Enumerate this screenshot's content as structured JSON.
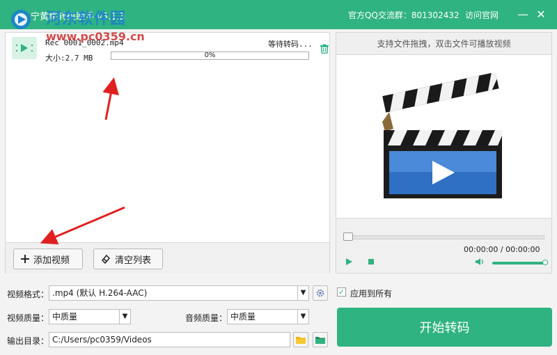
{
  "titlebar": {
    "app_title": "宁黄格转码助手 v3.1.3",
    "watermark_text": "河东软件园",
    "watermark_url": "www.pc0359.cn",
    "qq_group": "官方QQ交流群：801302432",
    "visit_site": "访问官网",
    "minimize_icon": "minimize-icon",
    "close_icon": "close-icon"
  },
  "file_list": {
    "items": [
      {
        "name": "Rec 0001_0002.mp4",
        "size": "大小:2.7 MB",
        "status": "等待转码...",
        "progress_text": "0%",
        "progress": 0
      }
    ]
  },
  "toolbar": {
    "add_video": "添加视频",
    "clear_list": "清空列表"
  },
  "preview": {
    "hint": "支持文件拖拽，双击文件可播放视频",
    "time": "00:00:00 / 00:00:00",
    "seek": 0,
    "volume": 1.0
  },
  "settings": {
    "format_label": "视频格式：",
    "format_value": ".mp4 (默认 H.264-AAC)",
    "apply_all": "应用到所有",
    "apply_all_checked": true,
    "video_quality_label": "视频质量：",
    "video_quality_value": "中质量",
    "audio_quality_label": "音频质量：",
    "audio_quality_value": "中质量",
    "output_label": "输出目录：",
    "output_path": "C:/Users/pc0359/Videos"
  },
  "start_button": "开始转码",
  "colors": {
    "accent": "#2fb380",
    "annotation_arrow": "#e02020"
  }
}
